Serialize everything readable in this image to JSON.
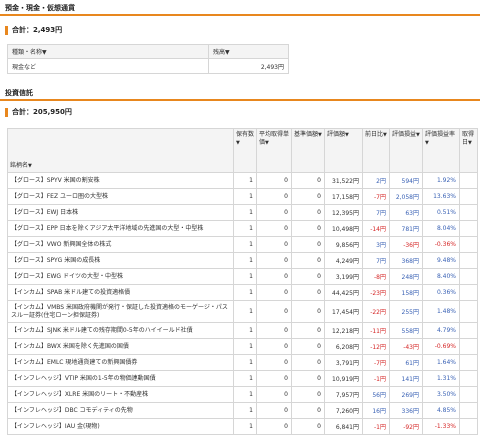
{
  "cash_section": {
    "title": "預金・現金・仮想通貨",
    "total_label": "合計：2,493円",
    "columns": [
      "種類・名称▼",
      "残高▼"
    ],
    "rows": [
      {
        "name": "現金など",
        "balance": "2,493円"
      }
    ]
  },
  "fund_section": {
    "title": "投資信託",
    "total_label": "合計：205,950円",
    "columns": [
      {
        "label": "銘柄名",
        "arrow": "▼"
      },
      {
        "label": "保有数",
        "arrow": "▼"
      },
      {
        "label": "平均取得単価",
        "arrow": "▼"
      },
      {
        "label": "基準価額",
        "arrow": "▼"
      },
      {
        "label": "評価額",
        "arrow": "▼"
      },
      {
        "label": "前日比",
        "arrow": "▼"
      },
      {
        "label": "評価損益",
        "arrow": "▼"
      },
      {
        "label": "評価損益率",
        "arrow": "▼"
      },
      {
        "label": "取得日",
        "arrow": "▼"
      }
    ],
    "rows": [
      {
        "name": "【グロース】SPYV 米国の割安株",
        "qty": "1",
        "avg": "0",
        "nav": "0",
        "value": "31,522円",
        "day": "2円",
        "pl": "594円",
        "rate": "1.92%",
        "dir": "pos"
      },
      {
        "name": "【グロース】FEZ ユーロ圏の大型株",
        "qty": "1",
        "avg": "0",
        "nav": "0",
        "value": "17,158円",
        "day": "-7円",
        "pl": "2,058円",
        "rate": "13.63%",
        "dir": "pos",
        "day_dir": "neg"
      },
      {
        "name": "【グロース】EWJ 日本株",
        "qty": "1",
        "avg": "0",
        "nav": "0",
        "value": "12,395円",
        "day": "7円",
        "pl": "63円",
        "rate": "0.51%",
        "dir": "pos"
      },
      {
        "name": "【グロース】EPP 日本を除くアジア太平洋地域の先進国の大型・中型株",
        "qty": "1",
        "avg": "0",
        "nav": "0",
        "value": "10,498円",
        "day": "-14円",
        "pl": "781円",
        "rate": "8.04%",
        "dir": "pos",
        "day_dir": "neg"
      },
      {
        "name": "【グロース】VWO 新興国全体の株式",
        "qty": "1",
        "avg": "0",
        "nav": "0",
        "value": "9,856円",
        "day": "3円",
        "pl": "-36円",
        "rate": "-0.36%",
        "dir": "neg",
        "day_dir": "pos"
      },
      {
        "name": "【グロース】SPYG 米国の成長株",
        "qty": "1",
        "avg": "0",
        "nav": "0",
        "value": "4,249円",
        "day": "7円",
        "pl": "368円",
        "rate": "9.48%",
        "dir": "pos"
      },
      {
        "name": "【グロース】EWG ドイツの大型・中型株",
        "qty": "1",
        "avg": "0",
        "nav": "0",
        "value": "3,199円",
        "day": "-8円",
        "pl": "248円",
        "rate": "8.40%",
        "dir": "pos",
        "day_dir": "neg"
      },
      {
        "name": "【インカム】SPAB 米ドル建ての投資適格債",
        "qty": "1",
        "avg": "0",
        "nav": "0",
        "value": "44,425円",
        "day": "-23円",
        "pl": "158円",
        "rate": "0.36%",
        "dir": "pos",
        "day_dir": "neg"
      },
      {
        "name": "【インカム】VMBS 米国政府機関が発行・保証した投資適格のモーゲージ・パススルー証券(住宅ローン担保証券)",
        "qty": "1",
        "avg": "0",
        "nav": "0",
        "value": "17,454円",
        "day": "-22円",
        "pl": "255円",
        "rate": "1.48%",
        "dir": "pos",
        "day_dir": "neg",
        "tall": true
      },
      {
        "name": "【インカム】SJNK 米ドル建ての残存期間0-5年のハイイールド社債",
        "qty": "1",
        "avg": "0",
        "nav": "0",
        "value": "12,218円",
        "day": "-11円",
        "pl": "558円",
        "rate": "4.79%",
        "dir": "pos",
        "day_dir": "neg"
      },
      {
        "name": "【インカム】BWX 米国を除く先進国の国債",
        "qty": "1",
        "avg": "0",
        "nav": "0",
        "value": "6,208円",
        "day": "-12円",
        "pl": "-43円",
        "rate": "-0.69%",
        "dir": "neg",
        "day_dir": "neg"
      },
      {
        "name": "【インカム】EMLC 現地通貨建ての新興国債券",
        "qty": "1",
        "avg": "0",
        "nav": "0",
        "value": "3,791円",
        "day": "-7円",
        "pl": "61円",
        "rate": "1.64%",
        "dir": "pos",
        "day_dir": "neg"
      },
      {
        "name": "【インフレヘッジ】VTIP 米国の1-5年の物価連動国債",
        "qty": "1",
        "avg": "0",
        "nav": "0",
        "value": "10,919円",
        "day": "-1円",
        "pl": "141円",
        "rate": "1.31%",
        "dir": "pos",
        "day_dir": "neg"
      },
      {
        "name": "【インフレヘッジ】XLRE 米国のリート・不動産株",
        "qty": "1",
        "avg": "0",
        "nav": "0",
        "value": "7,957円",
        "day": "56円",
        "pl": "269円",
        "rate": "3.50%",
        "dir": "pos"
      },
      {
        "name": "【インフレヘッジ】DBC コモディティの先物",
        "qty": "1",
        "avg": "0",
        "nav": "0",
        "value": "7,260円",
        "day": "16円",
        "pl": "336円",
        "rate": "4.85%",
        "dir": "pos"
      },
      {
        "name": "【インフレヘッジ】IAU 金(現物)",
        "qty": "1",
        "avg": "0",
        "nav": "0",
        "value": "6,841円",
        "day": "-1円",
        "pl": "-92円",
        "rate": "-1.33%",
        "dir": "neg",
        "day_dir": "neg"
      }
    ]
  }
}
